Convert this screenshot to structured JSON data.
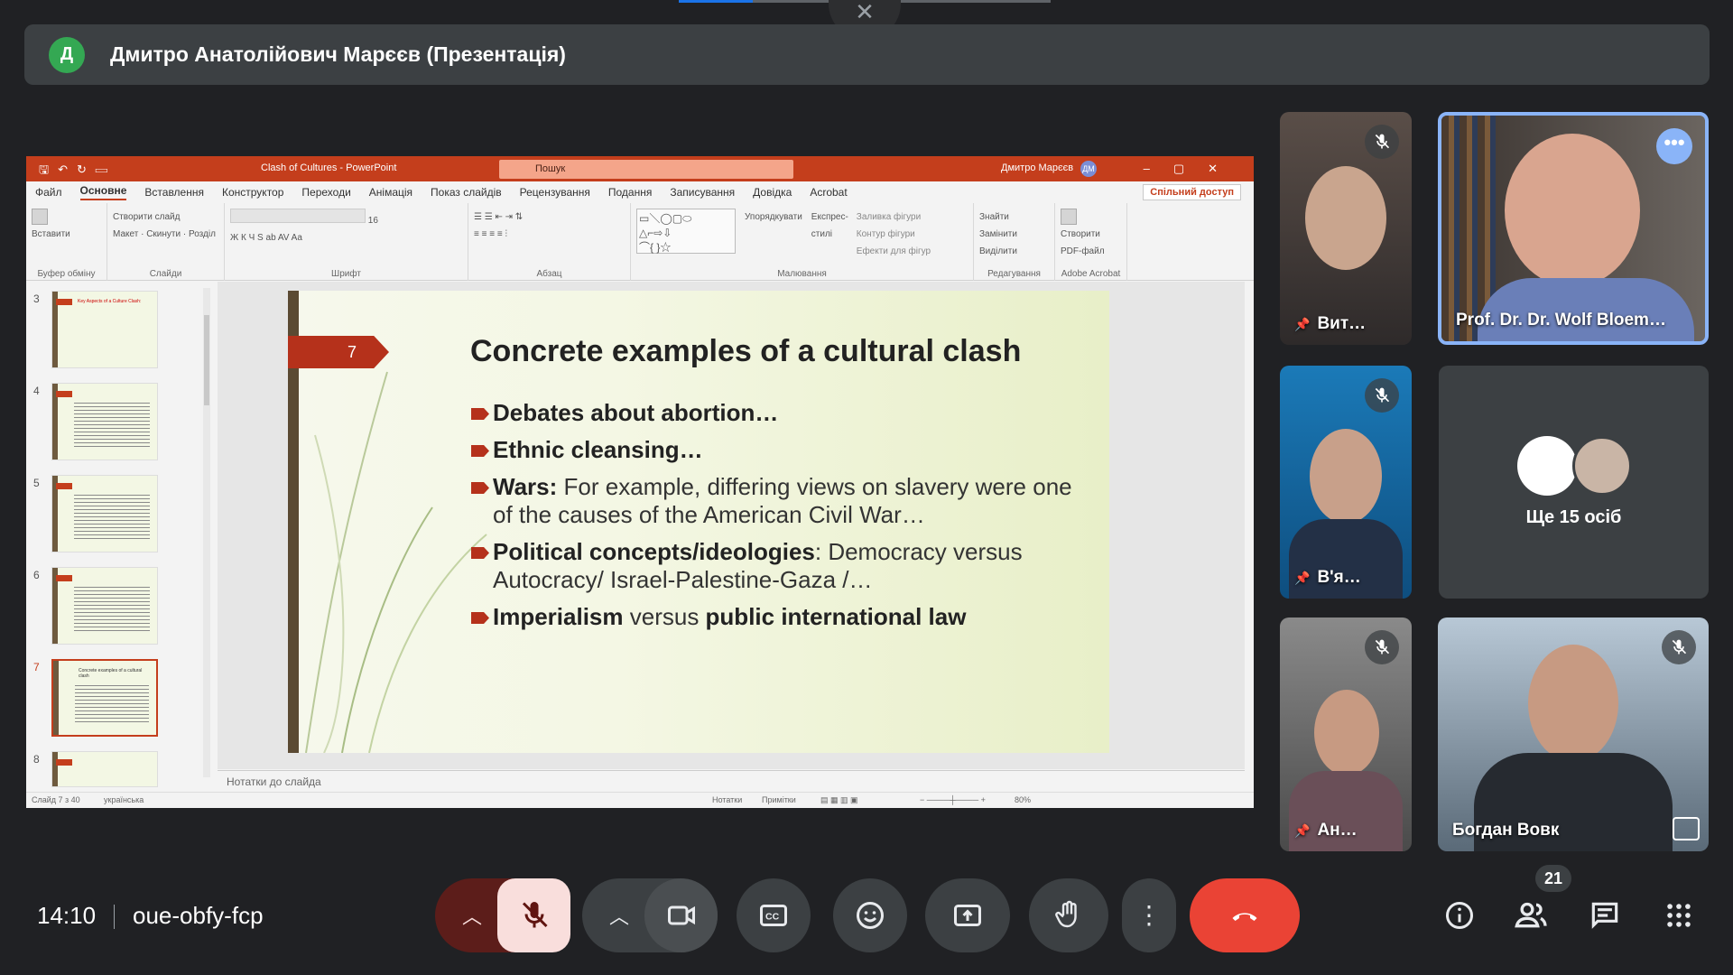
{
  "banner": {
    "avatar_letter": "Д",
    "title": "Дмитро Анатолійович Марєєв (Презентація)"
  },
  "ppt": {
    "doc_title": "Clash of Cultures  -  PowerPoint",
    "search_placeholder": "Пошук",
    "user_name": "Дмитро Марєєв",
    "user_initials": "ДМ",
    "tabs": [
      "Файл",
      "Основне",
      "Вставлення",
      "Конструктор",
      "Переходи",
      "Анімація",
      "Показ слайдів",
      "Рецензування",
      "Подання",
      "Записування",
      "Довідка",
      "Acrobat"
    ],
    "active_tab": "Основне",
    "share_label": "Спільний доступ",
    "groups": {
      "clipboard": {
        "label": "Буфер обміну",
        "paste": "Вставити"
      },
      "slides": {
        "label": "Слайди",
        "new_slide": "Створити слайд",
        "layout": "Макет",
        "reset": "Скинути",
        "section": "Розділ"
      },
      "font": {
        "label": "Шрифт",
        "size": "16"
      },
      "paragraph": {
        "label": "Абзац"
      },
      "drawing": {
        "label": "Малювання",
        "arrange": "Упорядкувати",
        "quick_styles": "Експрес-стилі",
        "fill": "Заливка фігури",
        "outline": "Контур фігури",
        "effects": "Ефекти для фігур"
      },
      "editing": {
        "label": "Редагування",
        "find": "Знайти",
        "replace": "Замінити",
        "select": "Виділити"
      },
      "acrobat": {
        "label": "Adobe Acrobat",
        "create_pdf": "Створити PDF-файл"
      }
    },
    "thumbnails": [
      {
        "num": "3",
        "title": "Key Aspects of a Culture Clash:"
      },
      {
        "num": "4",
        "title": ""
      },
      {
        "num": "5",
        "title": ""
      },
      {
        "num": "6",
        "title": ""
      },
      {
        "num": "7",
        "title": "Concrete examples of a cultural clash"
      },
      {
        "num": "8",
        "title": ""
      }
    ],
    "slide": {
      "number": "7",
      "title": "Concrete examples of a cultural clash",
      "bullets": [
        {
          "bold": "Debates about abortion…",
          "rest": ""
        },
        {
          "bold": "Ethnic cleansing…",
          "rest": ""
        },
        {
          "bold": "Wars:",
          "rest": " For example, differing views on slavery were one of the causes of the American Civil War…"
        },
        {
          "bold": "Political concepts/ideologies",
          "rest": ": Democracy versus Autocracy/ Israel-Palestine-Gaza /…"
        },
        {
          "bold": "Imperialism",
          "rest": " versus ",
          "bold2": "public international law"
        }
      ]
    },
    "notes_placeholder": "Нотатки до слайда",
    "status": {
      "slide_info": "Слайд 7 з 40",
      "language": "українська",
      "notes": "Нотатки",
      "comments": "Примітки",
      "zoom": "80%"
    }
  },
  "participants": [
    {
      "name": "Вит…",
      "pinned": true,
      "muted": true
    },
    {
      "name": "Prof. Dr. Dr. Wolf Bloem…",
      "active_speaker": true
    },
    {
      "name": "В'я…",
      "pinned": true,
      "muted": true
    },
    {
      "name": "Ан…",
      "pinned": true,
      "muted": true
    },
    {
      "name": "Богдан Вовк",
      "muted": true
    }
  ],
  "others_label": "Ще 15 осіб",
  "bottom": {
    "time": "14:10",
    "meeting_code": "oue-obfy-fcp",
    "people_count": "21"
  },
  "colors": {
    "accent": "#8ab4f8",
    "end_call": "#ea4335",
    "mic_off": "#f9dedc",
    "ppt_brand": "#c43e1c"
  }
}
